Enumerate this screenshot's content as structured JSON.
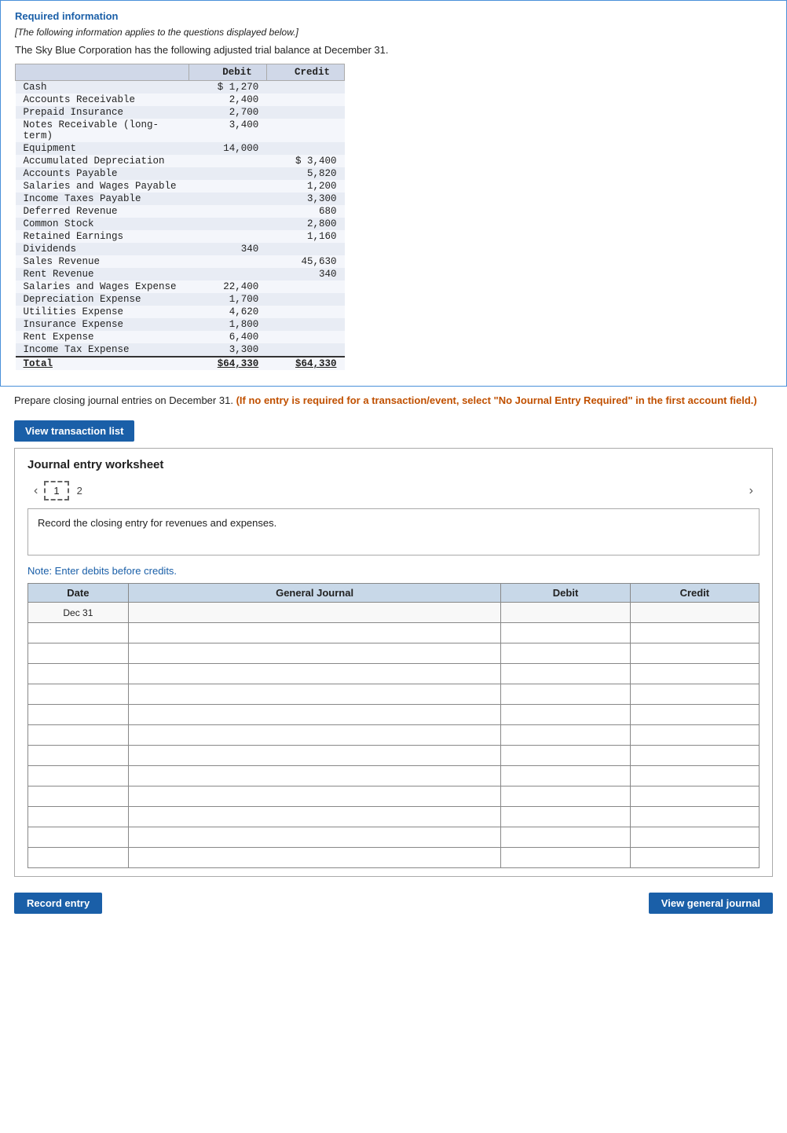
{
  "required_info": {
    "title": "Required information",
    "italic_note": "[The following information applies to the questions displayed below.]",
    "intro": "The Sky Blue Corporation has the following adjusted trial balance at December 31.",
    "table": {
      "headers": [
        "",
        "Debit",
        "Credit"
      ],
      "rows": [
        {
          "account": "Cash",
          "debit": "$ 1,270",
          "credit": ""
        },
        {
          "account": "Accounts Receivable",
          "debit": "2,400",
          "credit": ""
        },
        {
          "account": "Prepaid Insurance",
          "debit": "2,700",
          "credit": ""
        },
        {
          "account": "Notes Receivable (long-term)",
          "debit": "3,400",
          "credit": ""
        },
        {
          "account": "Equipment",
          "debit": "14,000",
          "credit": ""
        },
        {
          "account": "Accumulated Depreciation",
          "debit": "",
          "credit": "$ 3,400"
        },
        {
          "account": "Accounts Payable",
          "debit": "",
          "credit": "5,820"
        },
        {
          "account": "Salaries and Wages Payable",
          "debit": "",
          "credit": "1,200"
        },
        {
          "account": "Income Taxes Payable",
          "debit": "",
          "credit": "3,300"
        },
        {
          "account": "Deferred Revenue",
          "debit": "",
          "credit": "680"
        },
        {
          "account": "Common Stock",
          "debit": "",
          "credit": "2,800"
        },
        {
          "account": "Retained Earnings",
          "debit": "",
          "credit": "1,160"
        },
        {
          "account": "Dividends",
          "debit": "340",
          "credit": ""
        },
        {
          "account": "Sales Revenue",
          "debit": "",
          "credit": "45,630"
        },
        {
          "account": "Rent Revenue",
          "debit": "",
          "credit": "340"
        },
        {
          "account": "Salaries and Wages Expense",
          "debit": "22,400",
          "credit": ""
        },
        {
          "account": "Depreciation Expense",
          "debit": "1,700",
          "credit": ""
        },
        {
          "account": "Utilities Expense",
          "debit": "4,620",
          "credit": ""
        },
        {
          "account": "Insurance Expense",
          "debit": "1,800",
          "credit": ""
        },
        {
          "account": "Rent Expense",
          "debit": "6,400",
          "credit": ""
        },
        {
          "account": "Income Tax Expense",
          "debit": "3,300",
          "credit": ""
        },
        {
          "account": "Total",
          "debit": "$64,330",
          "credit": "$64,330"
        }
      ]
    }
  },
  "instruction": {
    "text_before": "Prepare closing journal entries on December 31.",
    "bold_text": "(If no entry is required for a transaction/event, select \"No Journal Entry Required\" in the first account field.)"
  },
  "view_transaction_btn": "View transaction list",
  "journal_worksheet": {
    "title": "Journal entry worksheet",
    "tabs": [
      {
        "label": "1",
        "active": true
      },
      {
        "label": "2",
        "active": false
      }
    ],
    "entry_description": "Record the closing entry for revenues and expenses.",
    "note": "Note: Enter debits before credits.",
    "table_headers": [
      "Date",
      "General Journal",
      "Debit",
      "Credit"
    ],
    "first_date": "Dec 31",
    "rows": 13
  },
  "buttons": {
    "record_entry": "Record entry",
    "view_general_journal": "View general journal"
  }
}
